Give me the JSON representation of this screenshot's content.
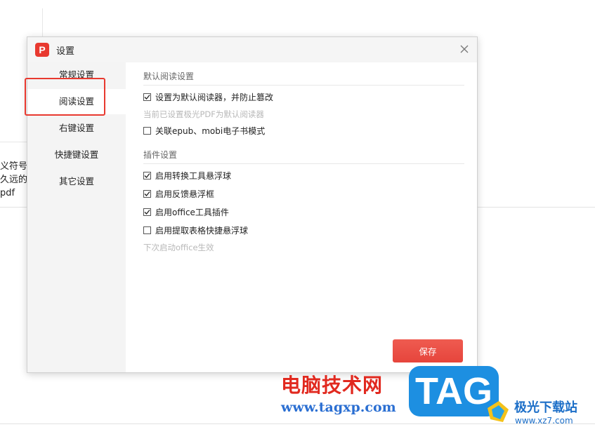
{
  "background": {
    "partial_text_lines": [
      "义符号话",
      "久远的方",
      "pdf"
    ]
  },
  "dialog": {
    "logo_letter": "P",
    "title": "设置",
    "close_icon": "close-icon"
  },
  "sidebar": {
    "items": [
      {
        "label": "常规设置"
      },
      {
        "label": "阅读设置"
      },
      {
        "label": "右键设置"
      },
      {
        "label": "快捷键设置"
      },
      {
        "label": "其它设置"
      }
    ],
    "active_index": 1
  },
  "content": {
    "reading_section": {
      "title": "默认阅读设置",
      "set_default": {
        "label": "设置为默认阅读器，并防止篡改",
        "checked": true
      },
      "hint": "当前已设置极光PDF为默认阅读器",
      "epub_mobi": {
        "label": "关联epub、mobi电子书模式",
        "checked": false
      }
    },
    "plugin_section": {
      "title": "插件设置",
      "options": [
        {
          "label": "启用转换工具悬浮球",
          "checked": true
        },
        {
          "label": "启用反馈悬浮框",
          "checked": true
        },
        {
          "label": "启用office工具插件",
          "checked": true
        },
        {
          "label": "启用提取表格快捷悬浮球",
          "checked": false
        }
      ],
      "hint": "下次启动office生效"
    },
    "save_label": "保存"
  },
  "watermark": {
    "site_name_cn": "电脑技术网",
    "site_url": "www.tagxp.com",
    "badge": "TAG",
    "brand_name": "极光下载站",
    "brand_url": "www.xz7.com"
  },
  "colors": {
    "accent": "#e8392f",
    "watermark_blue": "#1d8fe1"
  }
}
